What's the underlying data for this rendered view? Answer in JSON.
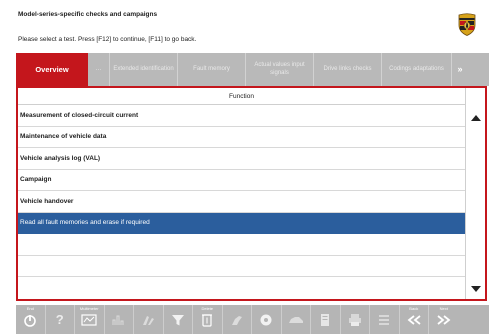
{
  "header": {
    "title": "Model-series-specific checks and campaigns",
    "instruction": "Please select a test. Press [F12] to continue, [F11] to go back."
  },
  "tabs": [
    {
      "label": "Overview",
      "active": true
    },
    {
      "label": "…",
      "active": false
    },
    {
      "label": "Extended identification",
      "active": false
    },
    {
      "label": "Fault memory",
      "active": false
    },
    {
      "label": "Actual values input signals",
      "active": false
    },
    {
      "label": "Drive links checks",
      "active": false
    },
    {
      "label": "Codings adaptations",
      "active": false
    }
  ],
  "tabs_more": "»",
  "table": {
    "column_header": "Function",
    "rows": [
      "Measurement of closed-circuit current",
      "Maintenance of vehicle data",
      "Vehicle analysis log (VAL)",
      "Campaign",
      "Vehicle handover",
      "Read all fault memories and erase if required"
    ],
    "selected_index": 5
  },
  "toolbar": {
    "buttons": [
      {
        "caption": "End",
        "icon": "power-icon"
      },
      {
        "caption": "",
        "icon": "help-icon",
        "glyph": "?"
      },
      {
        "caption": "Multimeter",
        "icon": "multimeter-icon"
      },
      {
        "caption": "",
        "icon": "signal-graph-icon"
      },
      {
        "caption": "",
        "icon": "car-icon"
      },
      {
        "caption": "",
        "icon": "filter-icon"
      },
      {
        "caption": "Delete",
        "icon": "delete-icon"
      },
      {
        "caption": "",
        "icon": "hand-icon"
      },
      {
        "caption": "",
        "icon": "record-icon"
      },
      {
        "caption": "",
        "icon": "vehicle-icon"
      },
      {
        "caption": "",
        "icon": "document-icon"
      },
      {
        "caption": "",
        "icon": "print-icon"
      },
      {
        "caption": "",
        "icon": "list-icon"
      },
      {
        "caption": "Back",
        "icon": "back-icon"
      },
      {
        "caption": "Next",
        "icon": "next-icon"
      }
    ]
  },
  "colors": {
    "accent": "#c4161c",
    "selection": "#2b5e9d",
    "toolbar": "#b5b5b5"
  }
}
